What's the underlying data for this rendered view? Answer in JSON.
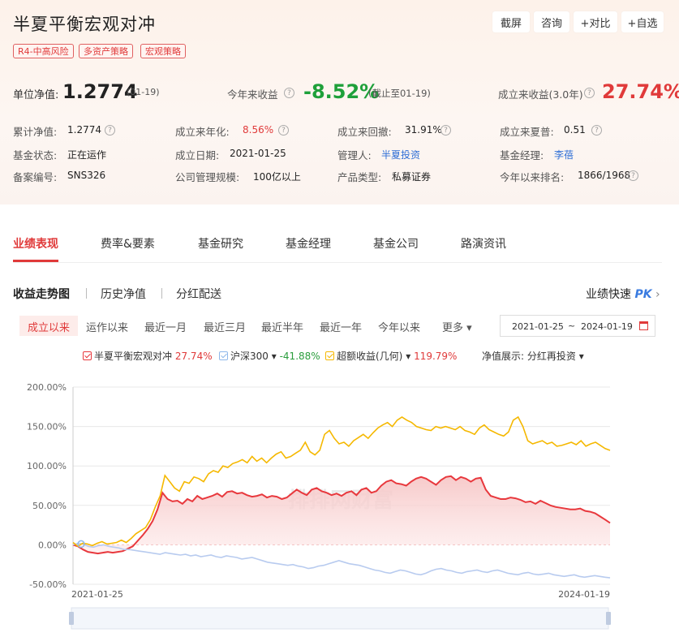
{
  "fund": {
    "title": "半夏平衡宏观对冲",
    "tags": [
      "R4-中高风险",
      "多资产策略",
      "宏观策略"
    ]
  },
  "actions": {
    "screenshot": "截屏",
    "consult": "咨询",
    "compare": "+对比",
    "watch": "+自选"
  },
  "summary": {
    "nav_label": "单位净值:",
    "nav_value": "1.2774",
    "nav_date": "(01-19)",
    "ytd_label": "今年来收益",
    "ytd_value": "-8.52%",
    "ytd_note": "(截止至01-19)",
    "since_label": "成立来收益(3.0年)",
    "since_value": "27.74%"
  },
  "details": [
    {
      "label": "累计净值:",
      "value": "1.2774",
      "help": true
    },
    {
      "label": "成立来年化:",
      "value": "8.56%",
      "help": true,
      "color": "#e03a3a"
    },
    {
      "label": "成立来回撤:",
      "value": "31.91%",
      "help": true
    },
    {
      "label": "成立来夏普:",
      "value": "0.51",
      "help": true
    },
    {
      "label": "基金状态:",
      "value": "正在运作"
    },
    {
      "label": "成立日期:",
      "value": "2021-01-25"
    },
    {
      "label": "管理人:",
      "value": "半夏投资",
      "color": "#2f6fd6"
    },
    {
      "label": "基金经理:",
      "value": "李蓓",
      "color": "#2f6fd6"
    },
    {
      "label": "备案编号:",
      "value": "SNS326"
    },
    {
      "label": "公司管理规模:",
      "value": "100亿以上"
    },
    {
      "label": "产品类型:",
      "value": "私募证券"
    },
    {
      "label": "今年以来排名:",
      "value": "1866/1968",
      "help": true
    }
  ],
  "tabs": [
    "业绩表现",
    "费率&要素",
    "基金研究",
    "基金经理",
    "基金公司",
    "路演资讯"
  ],
  "subtabs": [
    "收益走势图",
    "历史净值",
    "分红配送"
  ],
  "quick": {
    "label": "业绩快速",
    "pk": "PK"
  },
  "ranges": [
    "成立以来",
    "运作以来",
    "最近一月",
    "最近三月",
    "最近半年",
    "最近一年",
    "今年以来",
    "更多"
  ],
  "date_range": {
    "start": "2021-01-25",
    "sep": "~",
    "end": "2024-01-19"
  },
  "legend": [
    {
      "name": "半夏平衡宏观对冲",
      "value": "27.74%",
      "color": "#e8383d",
      "dropdown": false
    },
    {
      "name": "沪深300",
      "value": "-41.88%",
      "color": "#8fb8ea",
      "dropdown": true,
      "value_color": "#2a9d3c"
    },
    {
      "name": "超额收益(几何)",
      "value": "119.79%",
      "color": "#f5b800",
      "dropdown": true,
      "value_color": "#e03a3a"
    }
  ],
  "nav_display": {
    "label": "净值展示:",
    "value": "分红再投资"
  },
  "watermark": "排排网财富",
  "chart_data": {
    "type": "line",
    "x_start": "2021-01-25",
    "x_end": "2024-01-19",
    "y_ticks": [
      "200.00%",
      "150.00%",
      "100.00%",
      "50.00%",
      "0.00%",
      "-50.00%"
    ],
    "ylim": [
      -50,
      200
    ],
    "x_labels": [
      "2021-01-25",
      "2024-01-19"
    ],
    "series": [
      {
        "name": "半夏平衡宏观对冲",
        "color": "#e8383d",
        "area": true,
        "values": [
          0,
          -2,
          -6,
          -9,
          -10,
          -11,
          -10,
          -9,
          -10,
          -9,
          -8,
          -5,
          -2,
          5,
          12,
          20,
          30,
          45,
          66,
          58,
          55,
          56,
          52,
          58,
          55,
          62,
          58,
          60,
          62,
          65,
          61,
          67,
          68,
          65,
          66,
          63,
          61,
          62,
          64,
          60,
          62,
          61,
          58,
          60,
          65,
          70,
          66,
          63,
          70,
          72,
          68,
          66,
          63,
          65,
          62,
          66,
          68,
          63,
          70,
          72,
          66,
          68,
          75,
          80,
          82,
          78,
          77,
          75,
          80,
          84,
          86,
          84,
          80,
          76,
          82,
          86,
          87,
          82,
          86,
          84,
          80,
          84,
          85,
          70,
          62,
          60,
          58,
          58,
          60,
          59,
          57,
          54,
          55,
          52,
          56,
          53,
          50,
          48,
          47,
          46,
          45,
          45,
          46,
          43,
          42,
          40,
          36,
          32,
          27.74
        ]
      },
      {
        "name": "沪深300",
        "color": "#b8cbef",
        "area": false,
        "values": [
          0,
          2,
          1,
          -2,
          -3,
          -1,
          0,
          -2,
          -3,
          -4,
          -6,
          -6,
          -7,
          -8,
          -9,
          -10,
          -11,
          -12,
          -10,
          -11,
          -12,
          -13,
          -12,
          -14,
          -13,
          -15,
          -14,
          -13,
          -15,
          -16,
          -14,
          -15,
          -16,
          -18,
          -17,
          -16,
          -18,
          -20,
          -22,
          -23,
          -24,
          -25,
          -26,
          -25,
          -27,
          -28,
          -30,
          -29,
          -27,
          -26,
          -24,
          -22,
          -20,
          -22,
          -24,
          -25,
          -26,
          -28,
          -30,
          -32,
          -33,
          -35,
          -36,
          -34,
          -32,
          -33,
          -35,
          -37,
          -38,
          -36,
          -33,
          -31,
          -30,
          -32,
          -33,
          -35,
          -36,
          -34,
          -33,
          -32,
          -34,
          -35,
          -33,
          -32,
          -34,
          -36,
          -37,
          -38,
          -36,
          -35,
          -37,
          -38,
          -37,
          -36,
          -38,
          -39,
          -40,
          -39,
          -38,
          -40,
          -41,
          -40,
          -39,
          -40,
          -41,
          -41.88
        ]
      },
      {
        "name": "超额收益(几何)",
        "color": "#f5b800",
        "area": false,
        "values": [
          3,
          -2,
          2,
          1,
          -1,
          2,
          4,
          1,
          2,
          3,
          6,
          3,
          8,
          14,
          18,
          22,
          32,
          48,
          62,
          88,
          80,
          72,
          68,
          80,
          78,
          86,
          84,
          80,
          90,
          94,
          92,
          100,
          98,
          103,
          105,
          108,
          104,
          112,
          106,
          110,
          104,
          110,
          115,
          118,
          110,
          112,
          116,
          120,
          130,
          118,
          114,
          120,
          140,
          145,
          135,
          128,
          130,
          125,
          132,
          136,
          140,
          135,
          142,
          148,
          152,
          155,
          150,
          158,
          162,
          158,
          155,
          150,
          148,
          146,
          145,
          150,
          148,
          150,
          148,
          146,
          150,
          145,
          143,
          140,
          148,
          152,
          146,
          143,
          140,
          138,
          143,
          158,
          162,
          150,
          132,
          128,
          130,
          132,
          128,
          130,
          125,
          126,
          128,
          130,
          127,
          132,
          125,
          128,
          130,
          126,
          122,
          119.79
        ]
      }
    ]
  }
}
